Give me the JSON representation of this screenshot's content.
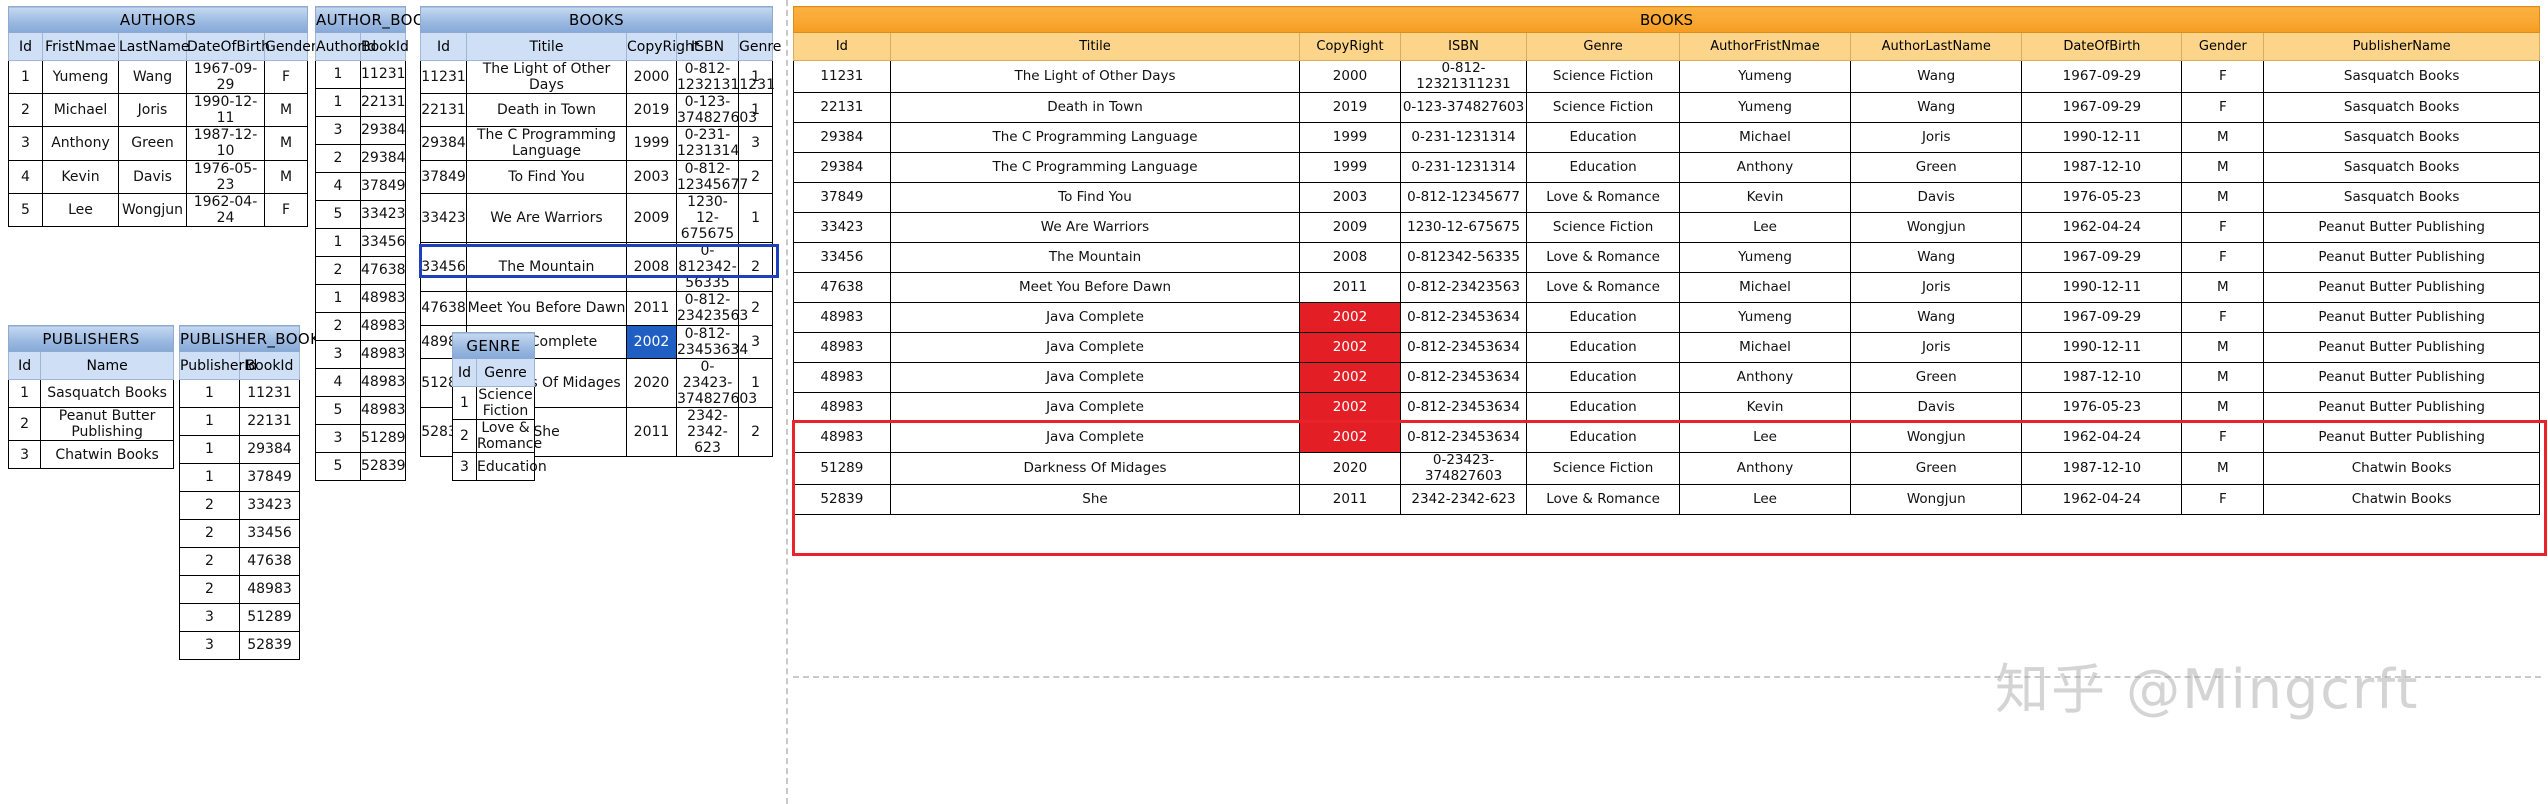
{
  "watermark": {
    "text": "知乎 @Mingcrft"
  },
  "tables": {
    "authors": {
      "title": "AUTHORS",
      "columns": [
        "Id",
        "FristNmae",
        "LastName",
        "DateOfBirth",
        "Gender"
      ],
      "rows": [
        [
          "1",
          "Yumeng",
          "Wang",
          "1967-09-29",
          "F"
        ],
        [
          "2",
          "Michael",
          "Joris",
          "1990-12-11",
          "M"
        ],
        [
          "3",
          "Anthony",
          "Green",
          "1987-12-10",
          "M"
        ],
        [
          "4",
          "Kevin",
          "Davis",
          "1976-05-23",
          "M"
        ],
        [
          "5",
          "Lee",
          "Wongjun",
          "1962-04-24",
          "F"
        ]
      ]
    },
    "publishers": {
      "title": "PUBLISHERS",
      "columns": [
        "Id",
        "Name"
      ],
      "rows": [
        [
          "1",
          "Sasquatch Books"
        ],
        [
          "2",
          "Peanut Butter Publishing"
        ],
        [
          "3",
          "Chatwin Books"
        ]
      ]
    },
    "publisher_book_map": {
      "title": "PUBLISHER_BOOK_MAP",
      "columns": [
        "PublisherId",
        "BookId"
      ],
      "rows": [
        [
          "1",
          "11231"
        ],
        [
          "1",
          "22131"
        ],
        [
          "1",
          "29384"
        ],
        [
          "1",
          "37849"
        ],
        [
          "2",
          "33423"
        ],
        [
          "2",
          "33456"
        ],
        [
          "2",
          "47638"
        ],
        [
          "2",
          "48983"
        ],
        [
          "3",
          "51289"
        ],
        [
          "3",
          "52839"
        ]
      ]
    },
    "author_book_map": {
      "title": "AUTHOR_BOOK_MAP",
      "columns": [
        "AuthorId",
        "BookId"
      ],
      "rows": [
        [
          "1",
          "11231"
        ],
        [
          "1",
          "22131"
        ],
        [
          "3",
          "29384"
        ],
        [
          "2",
          "29384"
        ],
        [
          "4",
          "37849"
        ],
        [
          "5",
          "33423"
        ],
        [
          "1",
          "33456"
        ],
        [
          "2",
          "47638"
        ],
        [
          "1",
          "48983"
        ],
        [
          "2",
          "48983"
        ],
        [
          "3",
          "48983"
        ],
        [
          "4",
          "48983"
        ],
        [
          "5",
          "48983"
        ],
        [
          "3",
          "51289"
        ],
        [
          "5",
          "52839"
        ]
      ]
    },
    "books": {
      "title": "BOOKS",
      "columns": [
        "Id",
        "Titile",
        "CopyRight",
        "ISBN",
        "Genre"
      ],
      "rows": [
        {
          "cells": [
            "11231",
            "The Light of Other Days",
            "2000",
            "0-812-12321311231",
            "1"
          ],
          "highlight": false
        },
        {
          "cells": [
            "22131",
            "Death in Town",
            "2019",
            "0-123-374827603",
            "1"
          ],
          "highlight": false
        },
        {
          "cells": [
            "29384",
            "The C Programming Language",
            "1999",
            "0-231-1231314",
            "3"
          ],
          "highlight": false
        },
        {
          "cells": [
            "37849",
            "To Find You",
            "2003",
            "0-812-12345677",
            "2"
          ],
          "highlight": false
        },
        {
          "cells": [
            "33423",
            "We Are Warriors",
            "2009",
            "1230-12-675675",
            "1"
          ],
          "highlight": false
        },
        {
          "cells": [
            "33456",
            "The Mountain",
            "2008",
            "0-812342-56335",
            "2"
          ],
          "highlight": false
        },
        {
          "cells": [
            "47638",
            "Meet You Before Dawn",
            "2011",
            "0-812-23423563",
            "2"
          ],
          "highlight": false
        },
        {
          "cells": [
            "48983",
            "Java Complete",
            "2002",
            "0-812-23453634",
            "3"
          ],
          "highlight": true
        },
        {
          "cells": [
            "51289",
            "Darkness Of Midages",
            "2020",
            "0-23423-374827603",
            "1"
          ],
          "highlight": false
        },
        {
          "cells": [
            "52839",
            "She",
            "2011",
            "2342-2342-623",
            "2"
          ],
          "highlight": false
        }
      ]
    },
    "genre": {
      "title": "GENRE",
      "columns": [
        "Id",
        "Genre"
      ],
      "rows": [
        [
          "1",
          "Science Fiction"
        ],
        [
          "2",
          "Love & Romance"
        ],
        [
          "3",
          "Education"
        ]
      ]
    },
    "books_denormalized": {
      "title": "BOOKS",
      "columns": [
        "Id",
        "Titile",
        "CopyRight",
        "ISBN",
        "Genre",
        "AuthorFristNmae",
        "AuthorLastName",
        "DateOfBirth",
        "Gender",
        "PublisherName"
      ],
      "rows": [
        {
          "cells": [
            "11231",
            "The Light of Other Days",
            "2000",
            "0-812-12321311231",
            "Science Fiction",
            "Yumeng",
            "Wang",
            "1967-09-29",
            "F",
            "Sasquatch Books"
          ],
          "highlight": false
        },
        {
          "cells": [
            "22131",
            "Death in Town",
            "2019",
            "0-123-374827603",
            "Science Fiction",
            "Yumeng",
            "Wang",
            "1967-09-29",
            "F",
            "Sasquatch Books"
          ],
          "highlight": false
        },
        {
          "cells": [
            "29384",
            "The C Programming Language",
            "1999",
            "0-231-1231314",
            "Education",
            "Michael",
            "Joris",
            "1990-12-11",
            "M",
            "Sasquatch Books"
          ],
          "highlight": false
        },
        {
          "cells": [
            "29384",
            "The C Programming Language",
            "1999",
            "0-231-1231314",
            "Education",
            "Anthony",
            "Green",
            "1987-12-10",
            "M",
            "Sasquatch Books"
          ],
          "highlight": false
        },
        {
          "cells": [
            "37849",
            "To Find You",
            "2003",
            "0-812-12345677",
            "Love & Romance",
            "Kevin",
            "Davis",
            "1976-05-23",
            "M",
            "Sasquatch Books"
          ],
          "highlight": false
        },
        {
          "cells": [
            "33423",
            "We Are Warriors",
            "2009",
            "1230-12-675675",
            "Science Fiction",
            "Lee",
            "Wongjun",
            "1962-04-24",
            "F",
            "Peanut Butter Publishing"
          ],
          "highlight": false
        },
        {
          "cells": [
            "33456",
            "The Mountain",
            "2008",
            "0-812342-56335",
            "Love & Romance",
            "Yumeng",
            "Wang",
            "1967-09-29",
            "F",
            "Peanut Butter Publishing"
          ],
          "highlight": false
        },
        {
          "cells": [
            "47638",
            "Meet You Before Dawn",
            "2011",
            "0-812-23423563",
            "Love & Romance",
            "Michael",
            "Joris",
            "1990-12-11",
            "M",
            "Peanut Butter Publishing"
          ],
          "highlight": false
        },
        {
          "cells": [
            "48983",
            "Java Complete",
            "2002",
            "0-812-23453634",
            "Education",
            "Yumeng",
            "Wang",
            "1967-09-29",
            "F",
            "Peanut Butter Publishing"
          ],
          "highlight": true
        },
        {
          "cells": [
            "48983",
            "Java Complete",
            "2002",
            "0-812-23453634",
            "Education",
            "Michael",
            "Joris",
            "1990-12-11",
            "M",
            "Peanut Butter Publishing"
          ],
          "highlight": true
        },
        {
          "cells": [
            "48983",
            "Java Complete",
            "2002",
            "0-812-23453634",
            "Education",
            "Anthony",
            "Green",
            "1987-12-10",
            "M",
            "Peanut Butter Publishing"
          ],
          "highlight": true
        },
        {
          "cells": [
            "48983",
            "Java Complete",
            "2002",
            "0-812-23453634",
            "Education",
            "Kevin",
            "Davis",
            "1976-05-23",
            "M",
            "Peanut Butter Publishing"
          ],
          "highlight": true
        },
        {
          "cells": [
            "48983",
            "Java Complete",
            "2002",
            "0-812-23453634",
            "Education",
            "Lee",
            "Wongjun",
            "1962-04-24",
            "F",
            "Peanut Butter Publishing"
          ],
          "highlight": true
        },
        {
          "cells": [
            "51289",
            "Darkness Of Midages",
            "2020",
            "0-23423-374827603",
            "Science Fiction",
            "Anthony",
            "Green",
            "1987-12-10",
            "M",
            "Chatwin Books"
          ],
          "highlight": false
        },
        {
          "cells": [
            "52839",
            "She",
            "2011",
            "2342-2342-623",
            "Love & Romance",
            "Lee",
            "Wongjun",
            "1962-04-24",
            "F",
            "Chatwin Books"
          ],
          "highlight": false
        }
      ]
    }
  }
}
